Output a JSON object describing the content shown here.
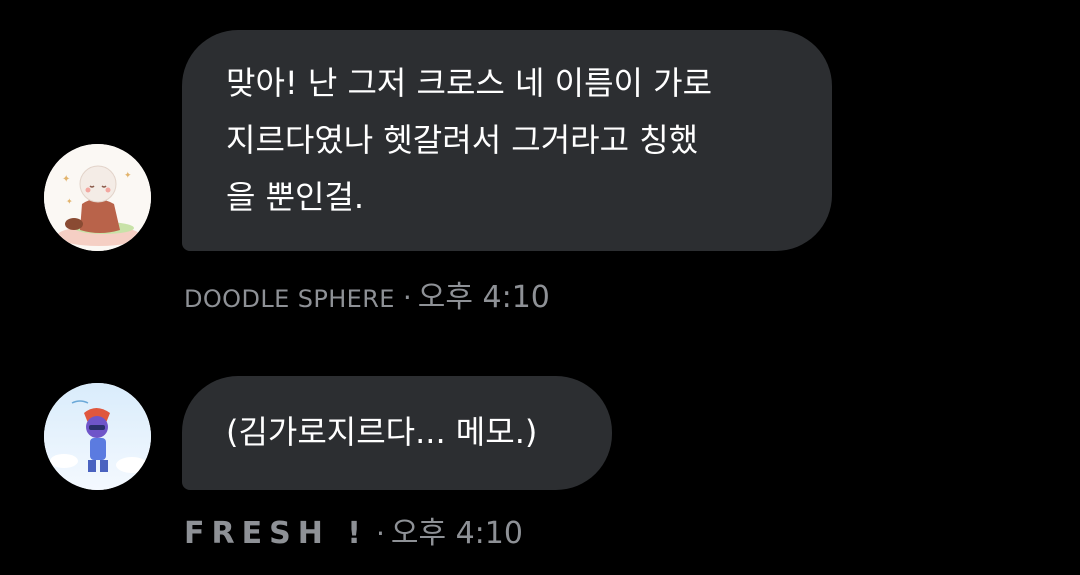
{
  "messages": [
    {
      "text_lines": [
        "맞아! 난 그저 크로스 네 이름이 가로",
        "지르다였나 헷갈려서 그거라고 칭했",
        "을 뿐인걸."
      ],
      "sender": "DOODLE SPHERE",
      "separator": "·",
      "time": "오후 4:10",
      "avatar_icon": "chibi-character-avatar-icon"
    },
    {
      "text": "(김가로지르다... 메모.)",
      "sender": "FRESH !",
      "separator": "·",
      "time": "오후 4:10",
      "avatar_icon": "blue-character-avatar-icon"
    }
  ],
  "colors": {
    "background": "#000000",
    "bubble": "#2c2e31",
    "message_text": "#ffffff",
    "meta_text": "#8e9196"
  }
}
